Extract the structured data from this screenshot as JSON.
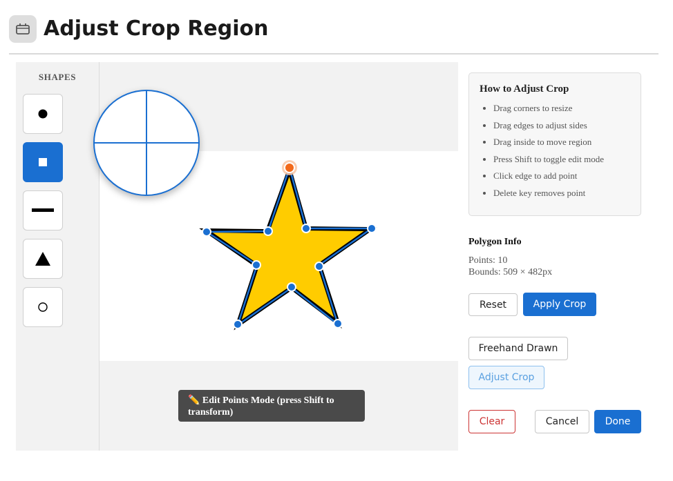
{
  "header": {
    "title": "Adjust Crop Region",
    "icon": "window-icon"
  },
  "sidebar": {
    "title": "SHAPES",
    "shapes": [
      {
        "name": "circle",
        "glyph": "●",
        "active": false
      },
      {
        "name": "square",
        "glyph": "■",
        "active": true
      },
      {
        "name": "line",
        "glyph": "▬",
        "active": false
      },
      {
        "name": "triangle",
        "glyph": "▲",
        "active": false
      },
      {
        "name": "circle-outline",
        "glyph": "○",
        "active": false
      }
    ]
  },
  "canvas": {
    "shape": "star",
    "fill_color": "#ffcc00",
    "stroke_color": "#000000",
    "outline_color": "#1a6fd1",
    "handle_color": "#1a6fd1",
    "rotate_handle_color": "#f26a1b",
    "mode_toast": "✏️ Edit Points Mode (press Shift to transform)"
  },
  "help": {
    "title": "How to Adjust Crop",
    "items": [
      "Drag corners to resize",
      "Drag edges to adjust sides",
      "Drag inside to move region",
      "Press Shift to toggle edit mode",
      "Click edge to add point",
      "Delete key removes point"
    ]
  },
  "polygon_info": {
    "title": "Polygon Info",
    "points_line": "Points: 10",
    "bounds_line": "Bounds: 509 × 482px"
  },
  "actions": {
    "reset": "Reset",
    "apply_crop": "Apply Crop",
    "freehand_drawn": "Freehand Drawn",
    "adjust_crop": "Adjust Crop",
    "clear": "Clear",
    "cancel": "Cancel",
    "done": "Done"
  },
  "colors": {
    "accent": "#1a6fd1",
    "danger": "#cc3333",
    "sidebar_bg": "#f2f2f2"
  }
}
